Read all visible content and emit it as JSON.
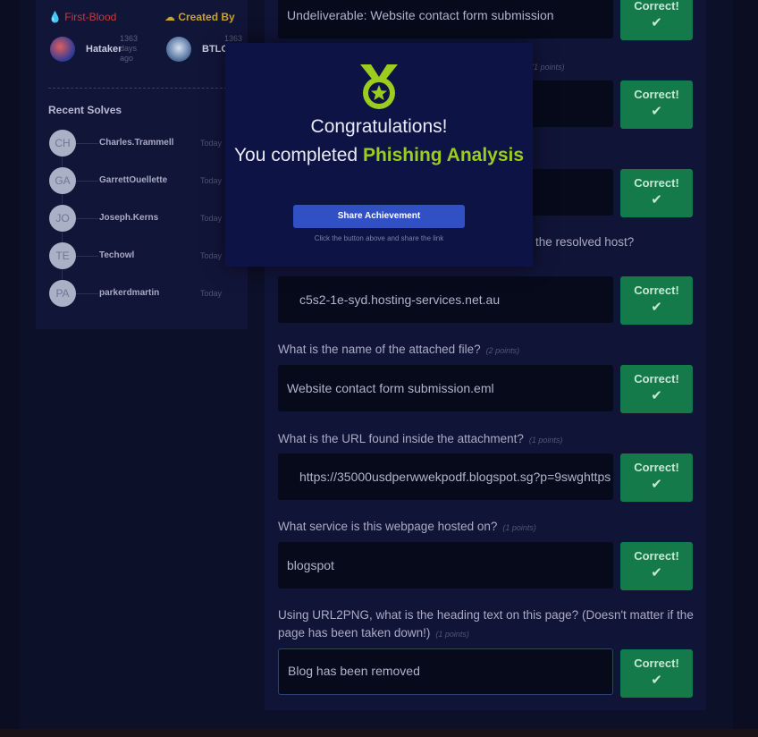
{
  "sidebar": {
    "first_blood": {
      "label": "First-Blood",
      "user": "Hataker",
      "days": "1363 days ago"
    },
    "created_by": {
      "label": "Created By",
      "user": "BTLO",
      "days": "1363"
    },
    "recent_title": "Recent Solves",
    "recent_solves": [
      {
        "initials": "CH",
        "name": "Charles.Trammell",
        "time": "Today"
      },
      {
        "initials": "GA",
        "name": "GarrettOuellette",
        "time": "Today"
      },
      {
        "initials": "JO",
        "name": "Joseph.Kerns",
        "time": "Today"
      },
      {
        "initials": "TE",
        "name": "Techowl",
        "time": "Today"
      },
      {
        "initials": "PA",
        "name": "parkerdmartin",
        "time": "Today"
      }
    ]
  },
  "questions": {
    "partial_q1_points": "(1 points)",
    "partial_q3_text": "the resolved host?",
    "items": [
      {
        "answer": "Undeliverable: Website contact form submission"
      },
      {
        "answer": ""
      },
      {
        "answer": ""
      },
      {
        "answer": "c5s2-1e-syd.hosting-services.net.au"
      },
      {
        "question": "What is the name of the attached file?",
        "points": "(2 points)",
        "answer": "Website contact form submission.eml"
      },
      {
        "question": "What is the URL found inside the attachment?",
        "points": "(1 points)",
        "answer": "https://35000usdperwwekpodf.blogspot.sg?p=9swghttps"
      },
      {
        "question": "What service is this webpage hosted on?",
        "points": "(1 points)",
        "answer": "blogspot"
      },
      {
        "question": "Using URL2PNG, what is the heading text on this page? (Doesn't matter if the page has been taken down!)",
        "points": "(1 points)",
        "answer": "Blog has been removed"
      }
    ],
    "correct_label": "Correct!"
  },
  "modal": {
    "title": "Congratulations!",
    "line2_prefix": "You completed",
    "challenge_name": "Phishing Analysis",
    "share_label": "Share Achievement",
    "hint": "Click the button above and share the link"
  },
  "colors": {
    "accent_green": "#9ccc1e",
    "correct_button": "#147a4a",
    "share_button": "#3150c4",
    "first_blood": "#c83a3a",
    "created_by": "#c9a227"
  }
}
